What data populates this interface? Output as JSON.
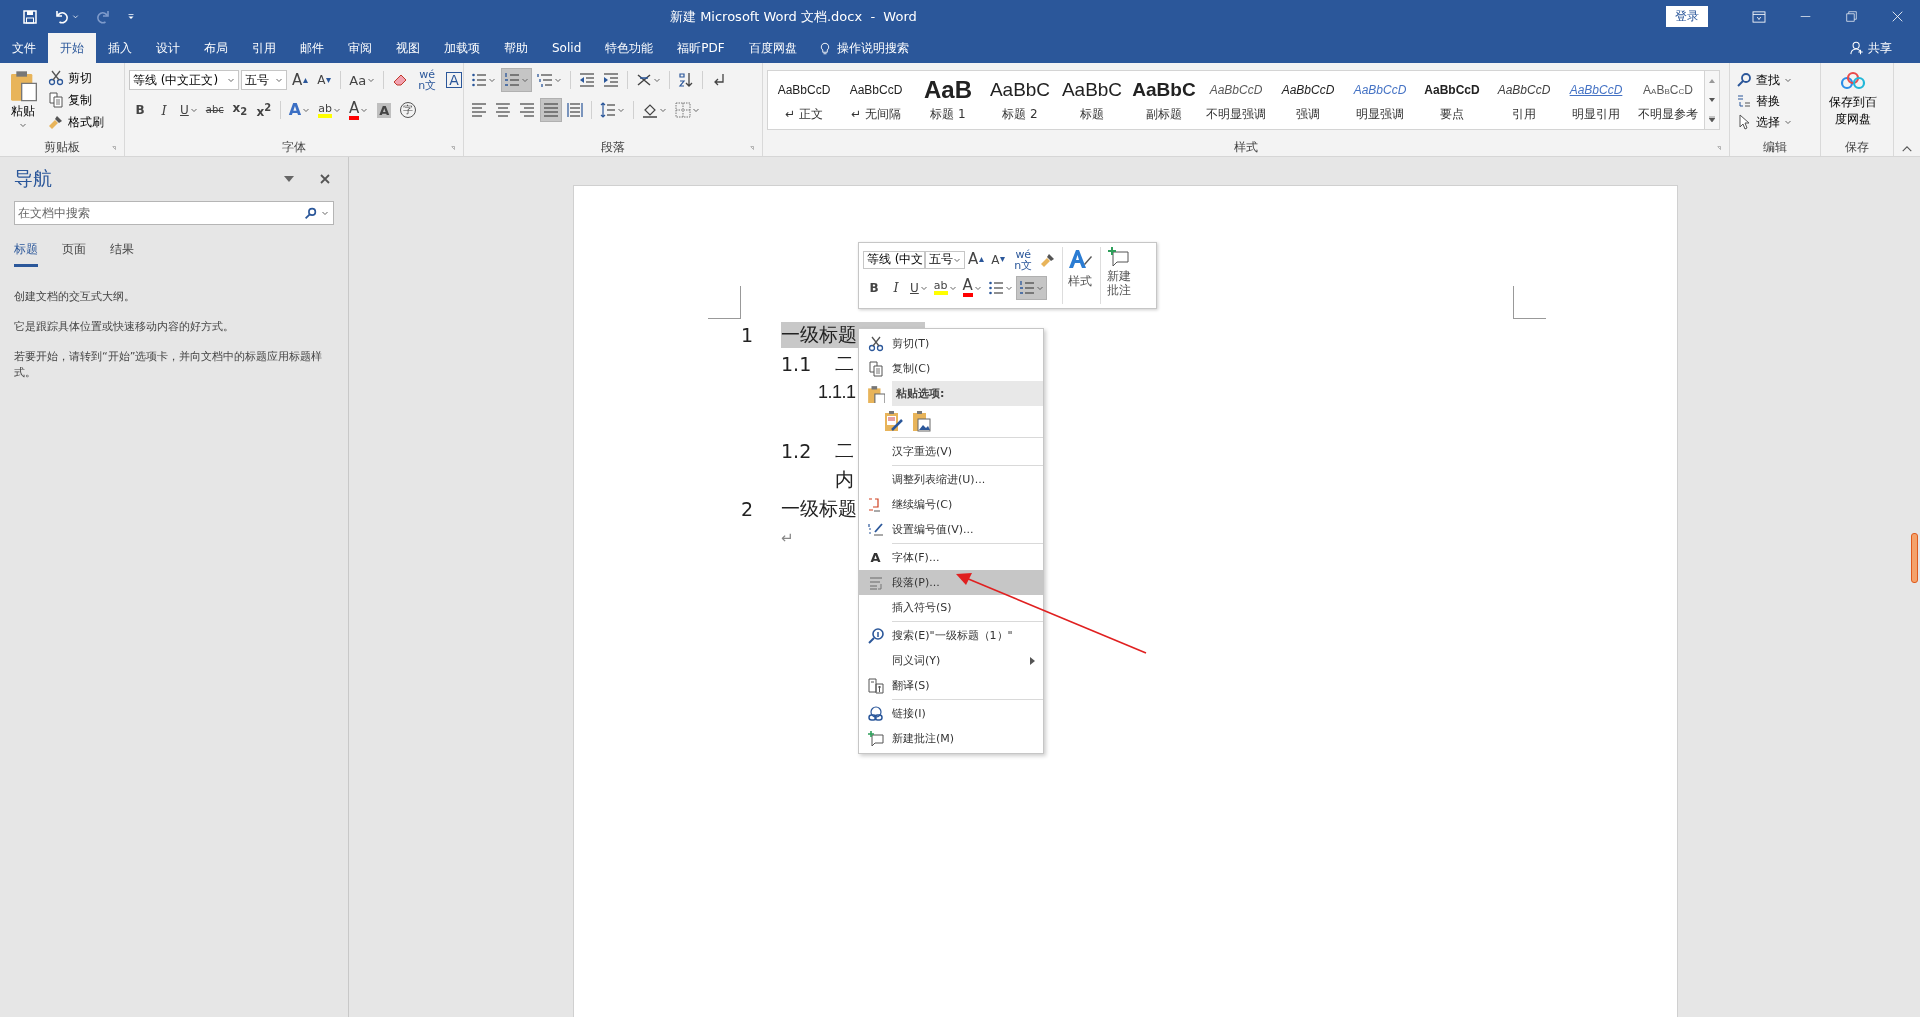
{
  "window": {
    "title": "新建 Microsoft Word 文档.docx  -  Word",
    "login": "登录"
  },
  "tabs": [
    {
      "label": "文件",
      "selected": false
    },
    {
      "label": "开始",
      "selected": true
    },
    {
      "label": "插入",
      "selected": false
    },
    {
      "label": "设计",
      "selected": false
    },
    {
      "label": "布局",
      "selected": false
    },
    {
      "label": "引用",
      "selected": false
    },
    {
      "label": "邮件",
      "selected": false
    },
    {
      "label": "审阅",
      "selected": false
    },
    {
      "label": "视图",
      "selected": false
    },
    {
      "label": "加载项",
      "selected": false
    },
    {
      "label": "帮助",
      "selected": false
    },
    {
      "label": "Solid",
      "selected": false
    },
    {
      "label": "特色功能",
      "selected": false
    },
    {
      "label": "福昕PDF",
      "selected": false
    },
    {
      "label": "百度网盘",
      "selected": false
    }
  ],
  "tell_me": "操作说明搜索",
  "share": "共享",
  "ribbon": {
    "clipboard": {
      "paste": "粘贴",
      "items": [
        {
          "kind": "cut",
          "text": "剪切"
        },
        {
          "kind": "copy",
          "text": "复制"
        },
        {
          "kind": "painter",
          "text": "格式刷"
        }
      ],
      "label": "剪贴板"
    },
    "font": {
      "font_name": "等线 (中文正文)",
      "font_size": "五号",
      "label": "字体",
      "row1": [
        {
          "kind": "grow",
          "text": "A"
        },
        {
          "kind": "shrink",
          "text": "A"
        },
        {
          "kind": "case",
          "text": "Aa"
        },
        {
          "kind": "clear"
        },
        {
          "kind": "phonetic",
          "text": "wén文"
        },
        {
          "kind": "border",
          "text": "A"
        }
      ],
      "row2": [
        {
          "kind": "bold",
          "text": "B"
        },
        {
          "kind": "italic",
          "text": "I"
        },
        {
          "kind": "underline",
          "text": "U"
        },
        {
          "kind": "strike",
          "text": "abc"
        },
        {
          "kind": "sub",
          "text": "x$_{2}$"
        },
        {
          "kind": "sup",
          "text": "x$^{2}$"
        },
        {
          "kind": "effects",
          "text": "A"
        },
        {
          "kind": "highlight",
          "text": "ab"
        },
        {
          "kind": "color",
          "text": "A"
        },
        {
          "kind": "shading",
          "text": "A"
        },
        {
          "kind": "enclose",
          "text": "字"
        }
      ]
    },
    "paragraph": {
      "label": "段落",
      "row1": [
        {
          "kind": "bullets",
          "selected": false
        },
        {
          "kind": "numbering",
          "selected": true
        },
        {
          "kind": "multilevel",
          "selected": false
        },
        {
          "kind": "outdent",
          "selected": false
        },
        {
          "kind": "indent",
          "selected": false
        },
        {
          "kind": "asian",
          "selected": false
        },
        {
          "kind": "sort",
          "selected": false
        },
        {
          "kind": "marks",
          "selected": false
        }
      ],
      "row2": [
        {
          "kind": "left",
          "selected": false
        },
        {
          "kind": "center",
          "selected": false
        },
        {
          "kind": "right",
          "selected": false
        },
        {
          "kind": "justify",
          "selected": true
        },
        {
          "kind": "distribute",
          "selected": false
        },
        {
          "kind": "spacing",
          "selected": false
        },
        {
          "kind": "pshading",
          "selected": false
        },
        {
          "kind": "borders",
          "selected": false
        }
      ]
    },
    "styles": {
      "label": "样式",
      "items": [
        {
          "kind": "normal",
          "preview": "AaBbCcD",
          "name": "↵ 正文"
        },
        {
          "kind": "normal",
          "preview": "AaBbCcD",
          "name": "↵ 无间隔"
        },
        {
          "kind": "h1",
          "preview": "AaB",
          "name": "标题 1"
        },
        {
          "kind": "h2",
          "preview": "AaBbC",
          "name": "标题 2"
        },
        {
          "kind": "title",
          "preview": "AaBbC",
          "name": "标题"
        },
        {
          "kind": "subtitle",
          "preview": "AaBbC",
          "name": "副标题"
        },
        {
          "kind": "subtle",
          "preview": "AaBbCcD",
          "name": "不明显强调"
        },
        {
          "kind": "emphasis",
          "preview": "AaBbCcD",
          "name": "强调"
        },
        {
          "kind": "intense",
          "preview": "AaBbCcD",
          "name": "明显强调"
        },
        {
          "kind": "strong",
          "preview": "AaBbCcD",
          "name": "要点"
        },
        {
          "kind": "quote",
          "preview": "AaBbCcD",
          "name": "引用"
        },
        {
          "kind": "iquote",
          "preview": "AaBbCcD",
          "name": "明显引用"
        },
        {
          "kind": "sref",
          "preview": "AaBbCcD",
          "name": "不明显参考"
        }
      ]
    },
    "editing": {
      "label": "编辑",
      "items": [
        {
          "kind": "find",
          "text": "查找"
        },
        {
          "kind": "replace",
          "text": "替换"
        },
        {
          "kind": "select",
          "text": "选择"
        }
      ]
    },
    "save": {
      "button": "保存到百度网盘",
      "label": "保存"
    }
  },
  "navigation": {
    "title": "导航",
    "search": {
      "placeholder": "在文档中搜索"
    },
    "tabs": [
      {
        "label": "标题",
        "selected": true
      },
      {
        "label": "页面",
        "selected": false
      },
      {
        "label": "结果",
        "selected": false
      }
    ],
    "paragraphs": [
      "创建文档的交互式大纲。",
      "它是跟踪具体位置或快速移动内容的好方式。",
      "若要开始，请转到“开始”选项卡，并向文档中的标题应用标题样式。"
    ]
  },
  "document": {
    "headings": [
      {
        "number": "1",
        "text": "一级标题",
        "selected": true,
        "children": [
          {
            "number": "1.1",
            "text": "二",
            "children": [
              {
                "number": "1.1.1"
              }
            ]
          },
          {
            "number": "1.2",
            "text": "二",
            "body": "内"
          }
        ]
      },
      {
        "number": "2",
        "text": "一级标题",
        "selected": false
      }
    ],
    "end_mark": "↵"
  },
  "mini_toolbar": {
    "font_name": "等线 (中文",
    "font_size": "五号",
    "row1": [
      {
        "kind": "grow",
        "text": "A"
      },
      {
        "kind": "shrink",
        "text": "A"
      },
      {
        "kind": "phonetic",
        "text": "wén文"
      },
      {
        "kind": "painter"
      }
    ],
    "row2": [
      {
        "kind": "bold",
        "text": "B",
        "selected": false
      },
      {
        "kind": "italic",
        "text": "I",
        "selected": false
      },
      {
        "kind": "underline",
        "text": "U",
        "selected": false
      },
      {
        "kind": "highlight",
        "text": "ab",
        "selected": false
      },
      {
        "kind": "color",
        "text": "A",
        "selected": false
      },
      {
        "kind": "bullets",
        "selected": false
      },
      {
        "kind": "numbering",
        "selected": true
      }
    ],
    "styles": "样式",
    "comment": "新建批注"
  },
  "context_menu": {
    "items": [
      {
        "kind": "cut",
        "text": "剪切(T)",
        "selected": false
      },
      {
        "kind": "copy",
        "text": "复制(C)",
        "selected": false
      },
      {
        "kind": "paste_header",
        "text": "粘贴选项:"
      },
      {
        "kind": "paste_options"
      },
      {
        "kind": "separator"
      },
      {
        "kind": "plain",
        "text": "汉字重选(V)",
        "selected": false
      },
      {
        "kind": "separator"
      },
      {
        "kind": "plain",
        "text": "调整列表缩进(U)...",
        "selected": false
      },
      {
        "kind": "continue",
        "text": "继续编号(C)",
        "selected": false
      },
      {
        "kind": "setnum",
        "text": "设置编号值(V)...",
        "selected": false
      },
      {
        "kind": "separator"
      },
      {
        "kind": "font",
        "glyph": "A",
        "text": "字体(F)...",
        "selected": false
      },
      {
        "kind": "paragraph",
        "text": "段落(P)...",
        "selected": true
      },
      {
        "kind": "plain",
        "text": "插入符号(S)",
        "selected": false
      },
      {
        "kind": "separator"
      },
      {
        "kind": "search",
        "text": "搜索(E)\"一级标题（1）\"",
        "selected": false
      },
      {
        "kind": "submenu",
        "text": "同义词(Y)",
        "selected": false
      },
      {
        "kind": "translate",
        "text": "翻译(S)",
        "selected": false
      },
      {
        "kind": "separator"
      },
      {
        "kind": "link",
        "text": "链接(I)",
        "selected": false
      },
      {
        "kind": "comment",
        "text": "新建批注(M)",
        "selected": false
      }
    ]
  }
}
